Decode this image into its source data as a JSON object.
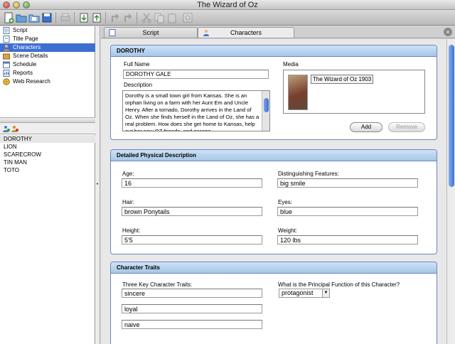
{
  "window": {
    "title": "The Wizard of Oz"
  },
  "nav": {
    "items": [
      {
        "label": "Script",
        "icon": "script-icon",
        "selected": false
      },
      {
        "label": "Title Page",
        "icon": "title-page-icon",
        "selected": false
      },
      {
        "label": "Characters",
        "icon": "characters-icon",
        "selected": true
      },
      {
        "label": "Scene Details",
        "icon": "scene-details-icon",
        "selected": false
      },
      {
        "label": "Schedule",
        "icon": "schedule-icon",
        "selected": false
      },
      {
        "label": "Reports",
        "icon": "reports-icon",
        "selected": false
      },
      {
        "label": "Web Research",
        "icon": "web-research-icon",
        "selected": false
      }
    ]
  },
  "characters": {
    "list": [
      "DOROTHY",
      "LION",
      "SCARECROW",
      "TIN MAN",
      "TOTO"
    ]
  },
  "tabs": [
    {
      "label": "Script"
    },
    {
      "label": "Characters"
    }
  ],
  "character": {
    "header": "DOROTHY",
    "full_name_label": "Full Name",
    "full_name": "DOROTHY GALE",
    "description_label": "Description",
    "description": "Dorothy is a small town girl from Kansas. She is an orphan living on a farm with her Aunt Em and Uncle Henry. After a tornado, Dorothy arrives in the Land of Oz. When she finds herself in the Land of Oz, she has a real problem. How does she get home to Kansas, help out her new OZ friends, and escape",
    "media_label": "Media",
    "media_caption": "The Wizard of Oz 1903",
    "add_button": "Add",
    "remove_button": "Remove"
  },
  "physical": {
    "header": "Detailed Physical Description",
    "age_label": "Age:",
    "age": "16",
    "features_label": "Distinguishing Features:",
    "features": "big smile",
    "hair_label": "Hair:",
    "hair": "brown Ponytails",
    "eyes_label": "Eyes:",
    "eyes": "blue",
    "height_label": "Height:",
    "height": "5'5",
    "weight_label": "Weight:",
    "weight": "120 lbs"
  },
  "traits": {
    "header": "Character Traits",
    "key_traits_label": "Three Key Character Traits:",
    "trait1": "sincere",
    "trait2": "loyal",
    "trait3": "naive",
    "function_label": "What is the Principal Function of this Character?",
    "function": "protagonist"
  },
  "colors": {
    "selection": "#3d6fd1",
    "panel_border": "#6f83c0",
    "panel_header": "#a7c6e6"
  }
}
